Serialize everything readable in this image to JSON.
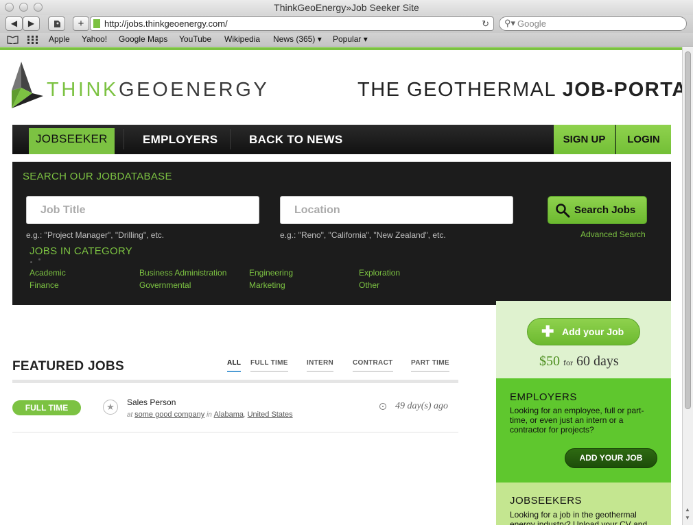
{
  "browser": {
    "window_title": "ThinkGeoEnergy»Job Seeker Site",
    "url": "http://jobs.thinkgeoenergy.com/",
    "search_placeholder": "Google",
    "back": "◀",
    "forward": "▶",
    "add": "+",
    "reload": "↻",
    "bookmarks": [
      "Apple",
      "Yahoo!",
      "Google Maps",
      "YouTube",
      "Wikipedia",
      "News (365) ▾",
      "Popular ▾"
    ]
  },
  "header": {
    "logo_think": "THINK",
    "logo_geo": "GEOENERGY",
    "tagline_light": "THE GEOTHERMAL ",
    "tagline_bold": "JOB-PORTAL"
  },
  "nav": {
    "items": [
      "JOBSEEKER",
      "EMPLOYERS",
      "BACK TO NEWS"
    ],
    "signup": "SIGN UP",
    "login": "LOGIN"
  },
  "search": {
    "title": "SEARCH OUR JOBDATABASE",
    "job_placeholder": "Job Title",
    "location_placeholder": "Location",
    "job_hint": "e.g.: \"Project Manager\", \"Drilling\", etc.",
    "location_hint": "e.g.: \"Reno\", \"California\", \"New Zealand\", etc.",
    "button": "Search Jobs",
    "advanced": "Advanced Search"
  },
  "categories": {
    "title": "JOBS IN CATEGORY",
    "items": [
      "Academic",
      "Business Administration",
      "Engineering",
      "Exploration",
      "Finance",
      "Governmental",
      "Marketing",
      "Other"
    ]
  },
  "featured": {
    "title": "FEATURED JOBS",
    "tabs": [
      "ALL",
      "FULL TIME",
      "INTERN",
      "CONTRACT",
      "PART TIME"
    ],
    "jobs": [
      {
        "type": "FULL TIME",
        "title": "Sales Person",
        "at": "at",
        "company": "some good company",
        "in": "in",
        "state": "Alabama",
        "country": "United States",
        "age": "49 day(s) ago"
      }
    ]
  },
  "sidebar": {
    "add_button": "Add your Job",
    "price": "$50",
    "price_for": "for",
    "price_duration": "60 days",
    "employers_title": "EMPLOYERS",
    "employers_text": "Looking for an employee, full or part-time, or even just an intern or a contractor for projects?",
    "employers_button": "ADD YOUR JOB",
    "jobseekers_title": "JOBSEEKERS",
    "jobseekers_text": "Looking for a job in the geothermal energy industry? Upload your CV and"
  }
}
